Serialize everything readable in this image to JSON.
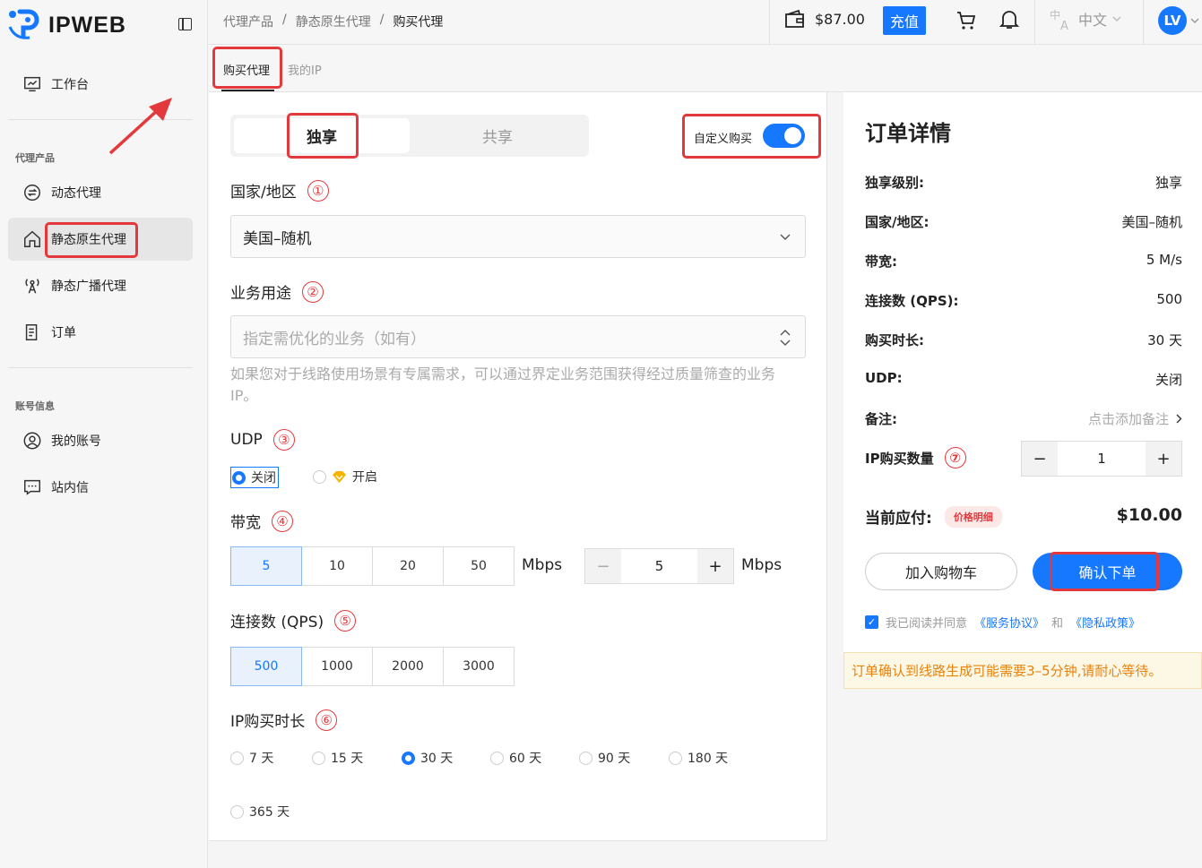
{
  "app": {
    "logo": "IPWEB"
  },
  "sidebar": {
    "workbench": "工作台",
    "section_proxy": "代理产品",
    "items_proxy": [
      {
        "label": "动态代理"
      },
      {
        "label": "静态原生代理"
      },
      {
        "label": "静态广播代理"
      },
      {
        "label": "订单"
      }
    ],
    "section_account": "账号信息",
    "items_account": [
      {
        "label": "我的账号"
      },
      {
        "label": "站内信"
      }
    ]
  },
  "header": {
    "breadcrumb": [
      "代理产品",
      "/",
      "静态原生代理",
      "/",
      "购买代理"
    ],
    "balance": "$87.00",
    "recharge": "充值",
    "language": "中文",
    "avatar": "LV"
  },
  "tabs": [
    "购买代理",
    "我的IP"
  ],
  "form": {
    "type_segment": {
      "exclusive": "独享",
      "shared": "共享"
    },
    "custom_buy": "自定义购买",
    "country": {
      "label": "国家/地区",
      "num": "①",
      "value": "美国–随机"
    },
    "usage": {
      "label": "业务用途",
      "num": "②",
      "placeholder": "指定需优化的业务（如有）",
      "hint": "如果您对于线路使用场景有专属需求，可以通过界定业务范围获得经过质量筛查的业务 IP。"
    },
    "udp": {
      "label": "UDP",
      "num": "③",
      "off": "关闭",
      "on": "开启"
    },
    "bandwidth": {
      "label": "带宽",
      "num": "④",
      "options": [
        "5",
        "10",
        "20",
        "50"
      ],
      "unit": "Mbps",
      "custom_value": "5",
      "custom_unit": "Mbps"
    },
    "qps": {
      "label": "连接数 (QPS)",
      "num": "⑤",
      "options": [
        "500",
        "1000",
        "2000",
        "3000"
      ]
    },
    "duration": {
      "label": "IP购买时长",
      "num": "⑥",
      "options": [
        "7 天",
        "15 天",
        "30 天",
        "60 天",
        "90 天",
        "180 天",
        "365 天"
      ]
    }
  },
  "order": {
    "title": "订单详情",
    "rows": [
      {
        "k": "独享级别:",
        "v": "独享"
      },
      {
        "k": "国家/地区:",
        "v": "美国–随机"
      },
      {
        "k": "带宽:",
        "v": "5 M/s"
      },
      {
        "k": "连接数 (QPS):",
        "v": "500"
      },
      {
        "k": "购买时长:",
        "v": "30 天"
      },
      {
        "k": "UDP:",
        "v": "关闭"
      }
    ],
    "note_label": "备注:",
    "note_action": "点击添加备注",
    "qty_label": "IP购买数量",
    "qty_num": "⑦",
    "qty": "1",
    "pay_label": "当前应付:",
    "price_detail": "价格明细",
    "total": "$10.00",
    "add_cart": "加入购物车",
    "confirm": "确认下单",
    "agree_text": "我已阅读并同意",
    "service": "《服务协议》",
    "and": "和",
    "privacy": "《隐私政策》",
    "notice": "订单确认到线路生成可能需要3–5分钟,请耐心等待。"
  },
  "colors": {
    "accent": "#1677ff",
    "annotation": "#e4393c"
  }
}
